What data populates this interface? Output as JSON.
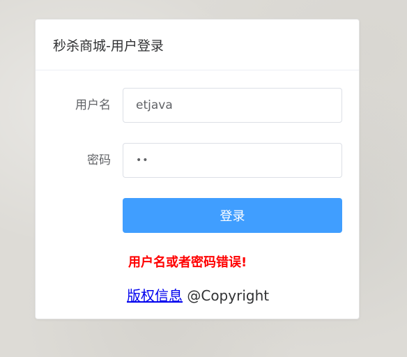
{
  "header": {
    "title": "秒杀商城-用户登录"
  },
  "form": {
    "username_label": "用户名",
    "username_value": "etjava",
    "password_label": "密码",
    "password_value": "••",
    "login_button_label": "登录"
  },
  "error": {
    "message": "用户名或者密码错误!"
  },
  "footer": {
    "copyright_link": "版权信息",
    "copyright_text": "@Copyright"
  },
  "colors": {
    "primary": "#409eff",
    "error": "#ff0000",
    "link": "#0000ee"
  }
}
